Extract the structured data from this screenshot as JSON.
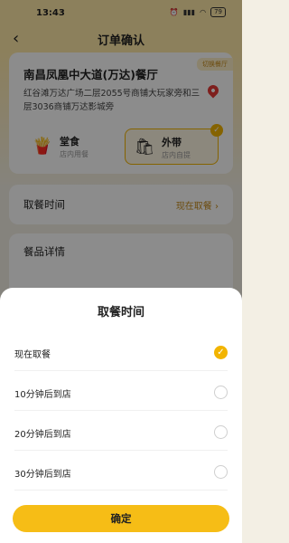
{
  "status_bar": {
    "time": "13:43",
    "battery": "79"
  },
  "nav": {
    "back_icon": "‹",
    "title": "订单确认"
  },
  "store": {
    "switch_label": "切换餐厅",
    "name": "南昌凤凰中大道(万达)餐厅",
    "address": "红谷滩万达广场二层2055号商铺大玩家旁和三层3036商铺万达影城旁"
  },
  "order_types": [
    {
      "label": "堂食",
      "sub": "店内用餐",
      "icon": "🍟",
      "selected": false
    },
    {
      "label": "外带",
      "sub": "店内自提",
      "icon": "🛍",
      "selected": true
    }
  ],
  "pickup": {
    "label": "取餐时间",
    "value": "现在取餐 ›"
  },
  "detail": {
    "label": "餐品详情"
  },
  "sheet": {
    "title": "取餐时间",
    "options": [
      {
        "label": "现在取餐",
        "selected": true
      },
      {
        "label": "10分钟后到店",
        "selected": false
      },
      {
        "label": "20分钟后到店",
        "selected": false
      },
      {
        "label": "30分钟后到店",
        "selected": false
      }
    ],
    "confirm_label": "确定"
  },
  "colors": {
    "accent": "#f6bd16",
    "header_bg": "#ffe9a8"
  }
}
